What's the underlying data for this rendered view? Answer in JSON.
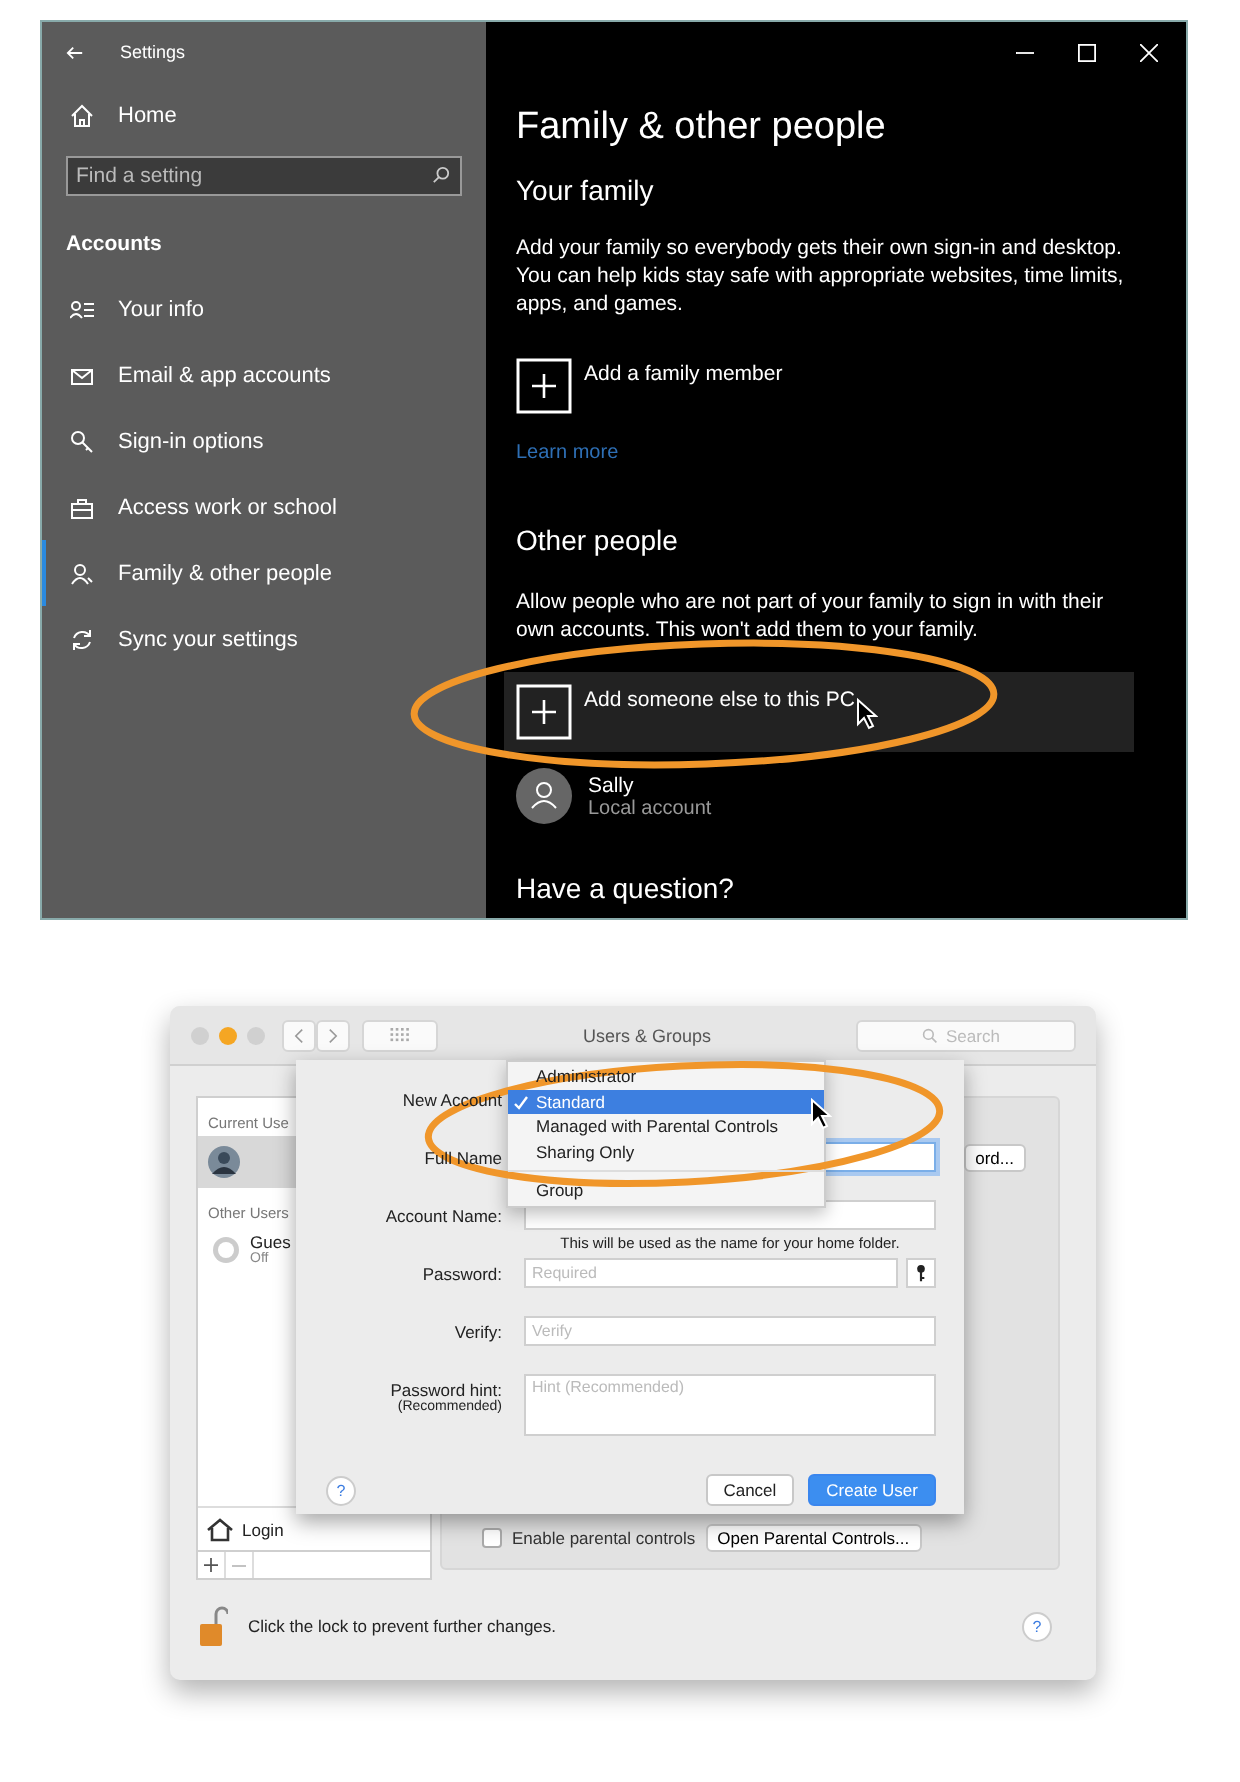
{
  "settings_window": {
    "title": "Settings",
    "home": "Home",
    "search": {
      "placeholder": "Find a setting"
    },
    "section": "Accounts",
    "items": [
      {
        "label": "Your info",
        "selected": false
      },
      {
        "label": "Email & app accounts",
        "selected": false
      },
      {
        "label": "Sign-in options",
        "selected": false
      },
      {
        "label": "Access work or school",
        "selected": false
      },
      {
        "label": "Family & other people",
        "selected": true
      },
      {
        "label": "Sync your settings",
        "selected": false
      }
    ],
    "page": {
      "title": "Family & other people",
      "your_family": {
        "heading": "Your family",
        "description": "Add your family so everybody gets their own sign-in and desktop. You can help kids stay safe with appropriate websites, time limits, apps, and games.",
        "add": {
          "label": "Add a family member",
          "highlighted": false
        },
        "link": "Learn more"
      },
      "other_people": {
        "heading": "Other people",
        "description": "Allow people who are not part of your family to sign in with their own accounts. This won't add them to your family.",
        "add": {
          "label": "Add someone else to this PC",
          "highlighted": true
        },
        "users": [
          {
            "name": "Sally",
            "type": "Local account"
          }
        ]
      },
      "question_heading": "Have a question?"
    }
  },
  "users_window": {
    "title": "Users & Groups",
    "search": {
      "placeholder": "Search"
    },
    "sidebar": {
      "current_header": "Current Use",
      "other_header": "Other Users",
      "guest": {
        "name": "Gues",
        "status": "Off"
      },
      "login": "Login"
    },
    "panel": {
      "button": "ord...",
      "parental": {
        "label": "Enable parental controls",
        "checked": false
      },
      "open_button": "Open Parental Controls..."
    },
    "lock_text": "Click the lock to prevent further changes.",
    "help": "?",
    "sheet": {
      "account_label": "New Account",
      "menu": [
        {
          "label": "Administrator",
          "selected": false,
          "separator_before": false
        },
        {
          "label": "Standard",
          "selected": true,
          "separator_before": false
        },
        {
          "label": "Managed with Parental Controls",
          "selected": false,
          "separator_before": false
        },
        {
          "label": "Sharing Only",
          "selected": false,
          "separator_before": false
        },
        {
          "label": "Group",
          "selected": false,
          "separator_before": true
        }
      ],
      "fields": [
        {
          "kind": "text",
          "label": "Full Name",
          "focused": true
        },
        {
          "kind": "text",
          "label": "Account Name:",
          "focused": false,
          "note": "This will be used as the name for your home folder."
        },
        {
          "kind": "password",
          "label": "Password:",
          "placeholder": "Required",
          "focused": false
        },
        {
          "kind": "text",
          "label": "Verify:",
          "placeholder": "Verify",
          "focused": false
        },
        {
          "kind": "area",
          "label": "Password hint:",
          "sublabel": "(Recommended)",
          "placeholder": "Hint (Recommended)",
          "focused": false
        }
      ],
      "help": "?",
      "buttons": [
        {
          "label": "Cancel",
          "primary": false
        },
        {
          "label": "Create User",
          "primary": true
        }
      ]
    }
  }
}
